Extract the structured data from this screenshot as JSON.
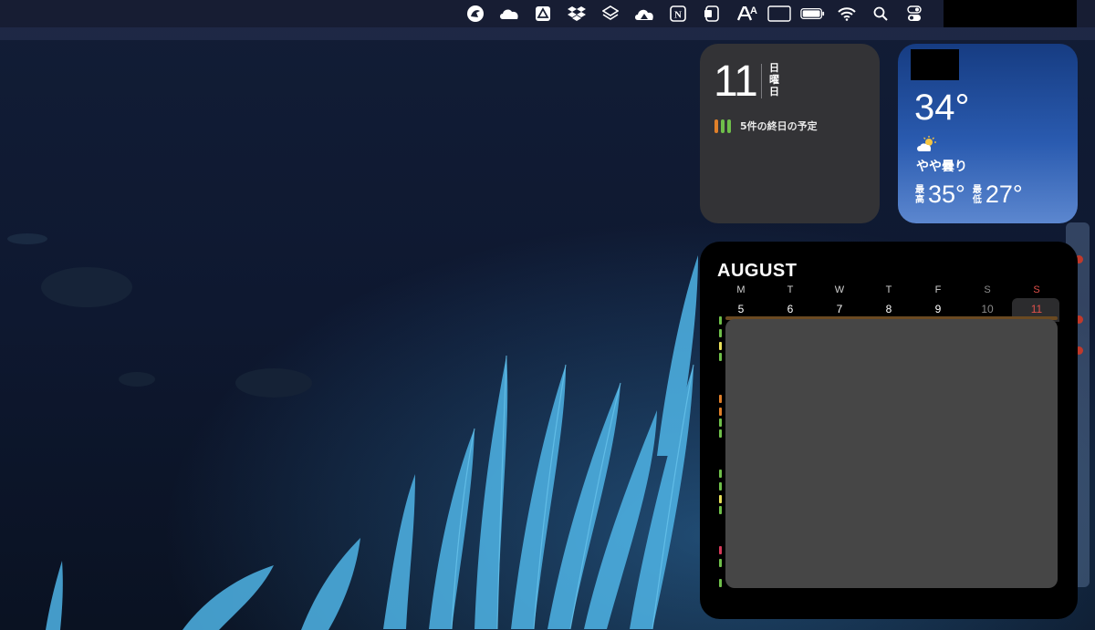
{
  "menubar": {
    "icons": [
      "streaks-icon",
      "onedrive-icon",
      "google-drive-icon",
      "dropbox-icon",
      "stack-icon",
      "cloud-mountain-icon",
      "notion-icon",
      "onenote-icon",
      "typeface-icon",
      "input-method-icon",
      "battery-icon",
      "wifi-icon",
      "search-icon",
      "control-center-icon"
    ],
    "input_method": "A"
  },
  "date_widget": {
    "day": "11",
    "weekday": "日曜日",
    "events": "5件の終日の予定",
    "event_colors": [
      "#e0802a",
      "#6fbf4a",
      "#6fbf4a"
    ]
  },
  "weather_widget": {
    "temp": "34°",
    "condition": "やや曇り",
    "high_label": "最高",
    "high": "35°",
    "low_label": "最低",
    "low": "27°",
    "icon": "partly-cloudy-sun-icon"
  },
  "calendar_widget": {
    "month": "AUGUST",
    "weekdays": [
      "M",
      "T",
      "W",
      "T",
      "F",
      "S",
      "S"
    ],
    "days": [
      "5",
      "6",
      "7",
      "8",
      "9",
      "10",
      "11"
    ],
    "today_index": 6,
    "accent": "#e0504a",
    "event_line_colors": [
      "#6fbf4a",
      "#6fbf4a",
      "#e8e05a",
      "#6fbf4a",
      "#e0802a",
      "#e0802a",
      "#6fbf4a",
      "#6fbf4a",
      "#6fbf4a",
      "#6fbf4a",
      "#e8e05a",
      "#6fbf4a",
      "#d63a5a",
      "#6fbf4a",
      "#6fbf4a"
    ]
  }
}
